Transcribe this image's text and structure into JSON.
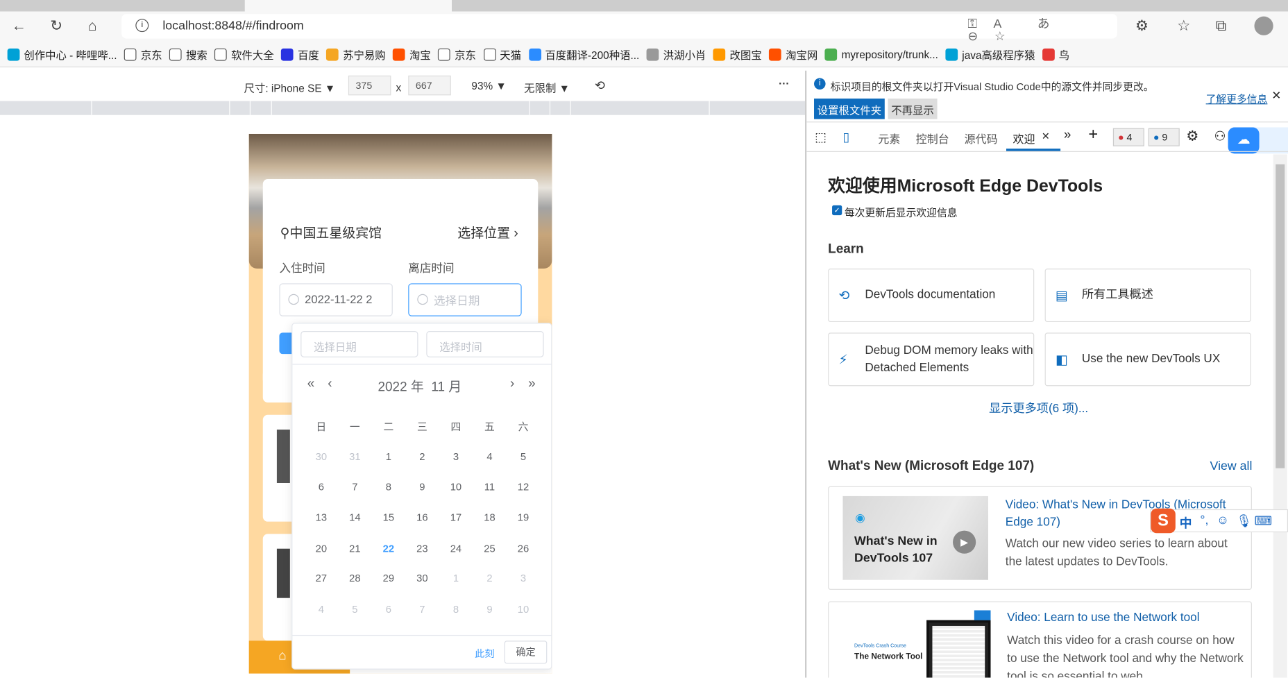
{
  "browser": {
    "url": "localhost:8848/#/findroom",
    "bookmarks": [
      "创作中心 - 哔哩哔...",
      "京东",
      "搜索",
      "软件大全",
      "百度",
      "苏宁易购",
      "淘宝",
      "京东",
      "天猫",
      "百度翻译-200种语...",
      "洪湖小肖",
      "改图宝",
      "淘宝网",
      "myrepository/trunk...",
      "java高级程序猿",
      "鸟"
    ]
  },
  "device_toolbar": {
    "size_label": "尺寸: iPhone SE",
    "width": "375",
    "x": "x",
    "height": "667",
    "zoom": "93%",
    "throttle": "无限制",
    "more": "···"
  },
  "app": {
    "location": "中国五星级宾馆",
    "choose_location": "选择位置",
    "checkin_label": "入住时间",
    "checkout_label": "离店时间",
    "checkin_value": "2022-11-22 2",
    "checkout_placeholder": "选择日期",
    "picker": {
      "date_placeholder": "选择日期",
      "time_placeholder": "选择时间",
      "year_month": "2022 年  11 月",
      "now": "此刻",
      "ok": "确定",
      "weekdays": [
        "日",
        "一",
        "二",
        "三",
        "四",
        "五",
        "六"
      ],
      "weeks": [
        [
          "30",
          "31",
          "1",
          "2",
          "3",
          "4",
          "5"
        ],
        [
          "6",
          "7",
          "8",
          "9",
          "10",
          "11",
          "12"
        ],
        [
          "13",
          "14",
          "15",
          "16",
          "17",
          "18",
          "19"
        ],
        [
          "20",
          "21",
          "22",
          "23",
          "24",
          "25",
          "26"
        ],
        [
          "27",
          "28",
          "29",
          "30",
          "1",
          "2",
          "3"
        ],
        [
          "4",
          "5",
          "6",
          "7",
          "8",
          "9",
          "10"
        ]
      ],
      "today": "22"
    }
  },
  "devtools": {
    "info": "标识项目的根文件夹以打开Visual Studio Code中的源文件并同步更改。",
    "learn_more": "了解更多信息",
    "set_root": "设置根文件夹",
    "dont_show": "不再显示",
    "tabs": [
      "元素",
      "控制台",
      "源代码",
      "欢迎"
    ],
    "errors": "4",
    "messages": "9",
    "title": "欢迎使用Microsoft Edge DevTools",
    "checkbox": "每次更新后显示欢迎信息",
    "learn": "Learn",
    "cards": [
      "DevTools documentation",
      "所有工具概述",
      "Debug DOM memory leaks with Detached Elements",
      "Use the new DevTools UX"
    ],
    "show_more": "显示更多项(6 项)...",
    "whats_new": "What's New (Microsoft Edge 107)",
    "view_all": "View all",
    "videos": [
      {
        "thumb": "What's New in DevTools 107",
        "title": "Video: What's New in DevTools (Microsoft Edge 107)",
        "desc": "Watch our new video series to learn about the latest updates to DevTools."
      },
      {
        "thumb_small": "DevTools Crash Course",
        "thumb": "The Network Tool",
        "title": "Video: Learn to use the Network tool",
        "desc": "Watch this video for a crash course on how to use the Network tool and why the Network tool is so essential to web"
      }
    ]
  },
  "ime": {
    "lang": "中",
    "punct": "°,"
  }
}
